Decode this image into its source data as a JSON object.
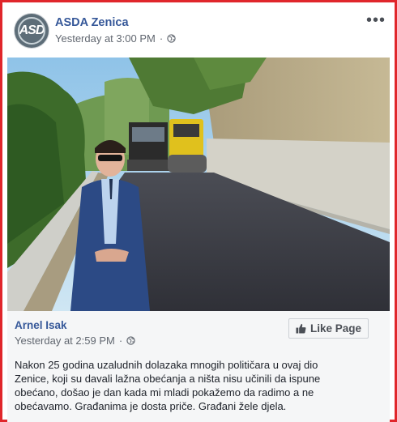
{
  "post": {
    "page_name": "ASDA Zenica",
    "avatar_text": "ASD",
    "timestamp": "Yesterday at 3:00 PM",
    "separator": "·",
    "privacy_icon": "globe-icon",
    "more_icon": "more-options-icon",
    "more_label": "•••"
  },
  "shared": {
    "author": "Arnel Isak",
    "timestamp": "Yesterday at 2:59 PM",
    "separator": "·",
    "privacy_icon": "globe-icon",
    "like_page_label": "Like Page",
    "like_page_icon": "thumbs-up-icon",
    "text_lines": [
      "Nakon 25 godina uzaludnih dolazaka mnogih političara u ovaj dio",
      "Zenice, koji su davali lažna obećanja a ništa nisu učinili da ispune",
      "obećano, došao je dan kada mi mladi pokažemo da radimo a ne",
      "obećavamo. Građanima je dosta priče. Građani žele djela."
    ]
  },
  "colors": {
    "frame_border": "#e0262b",
    "link_blue": "#365899",
    "meta_gray": "#616770",
    "share_background": "#f5f6f7"
  }
}
